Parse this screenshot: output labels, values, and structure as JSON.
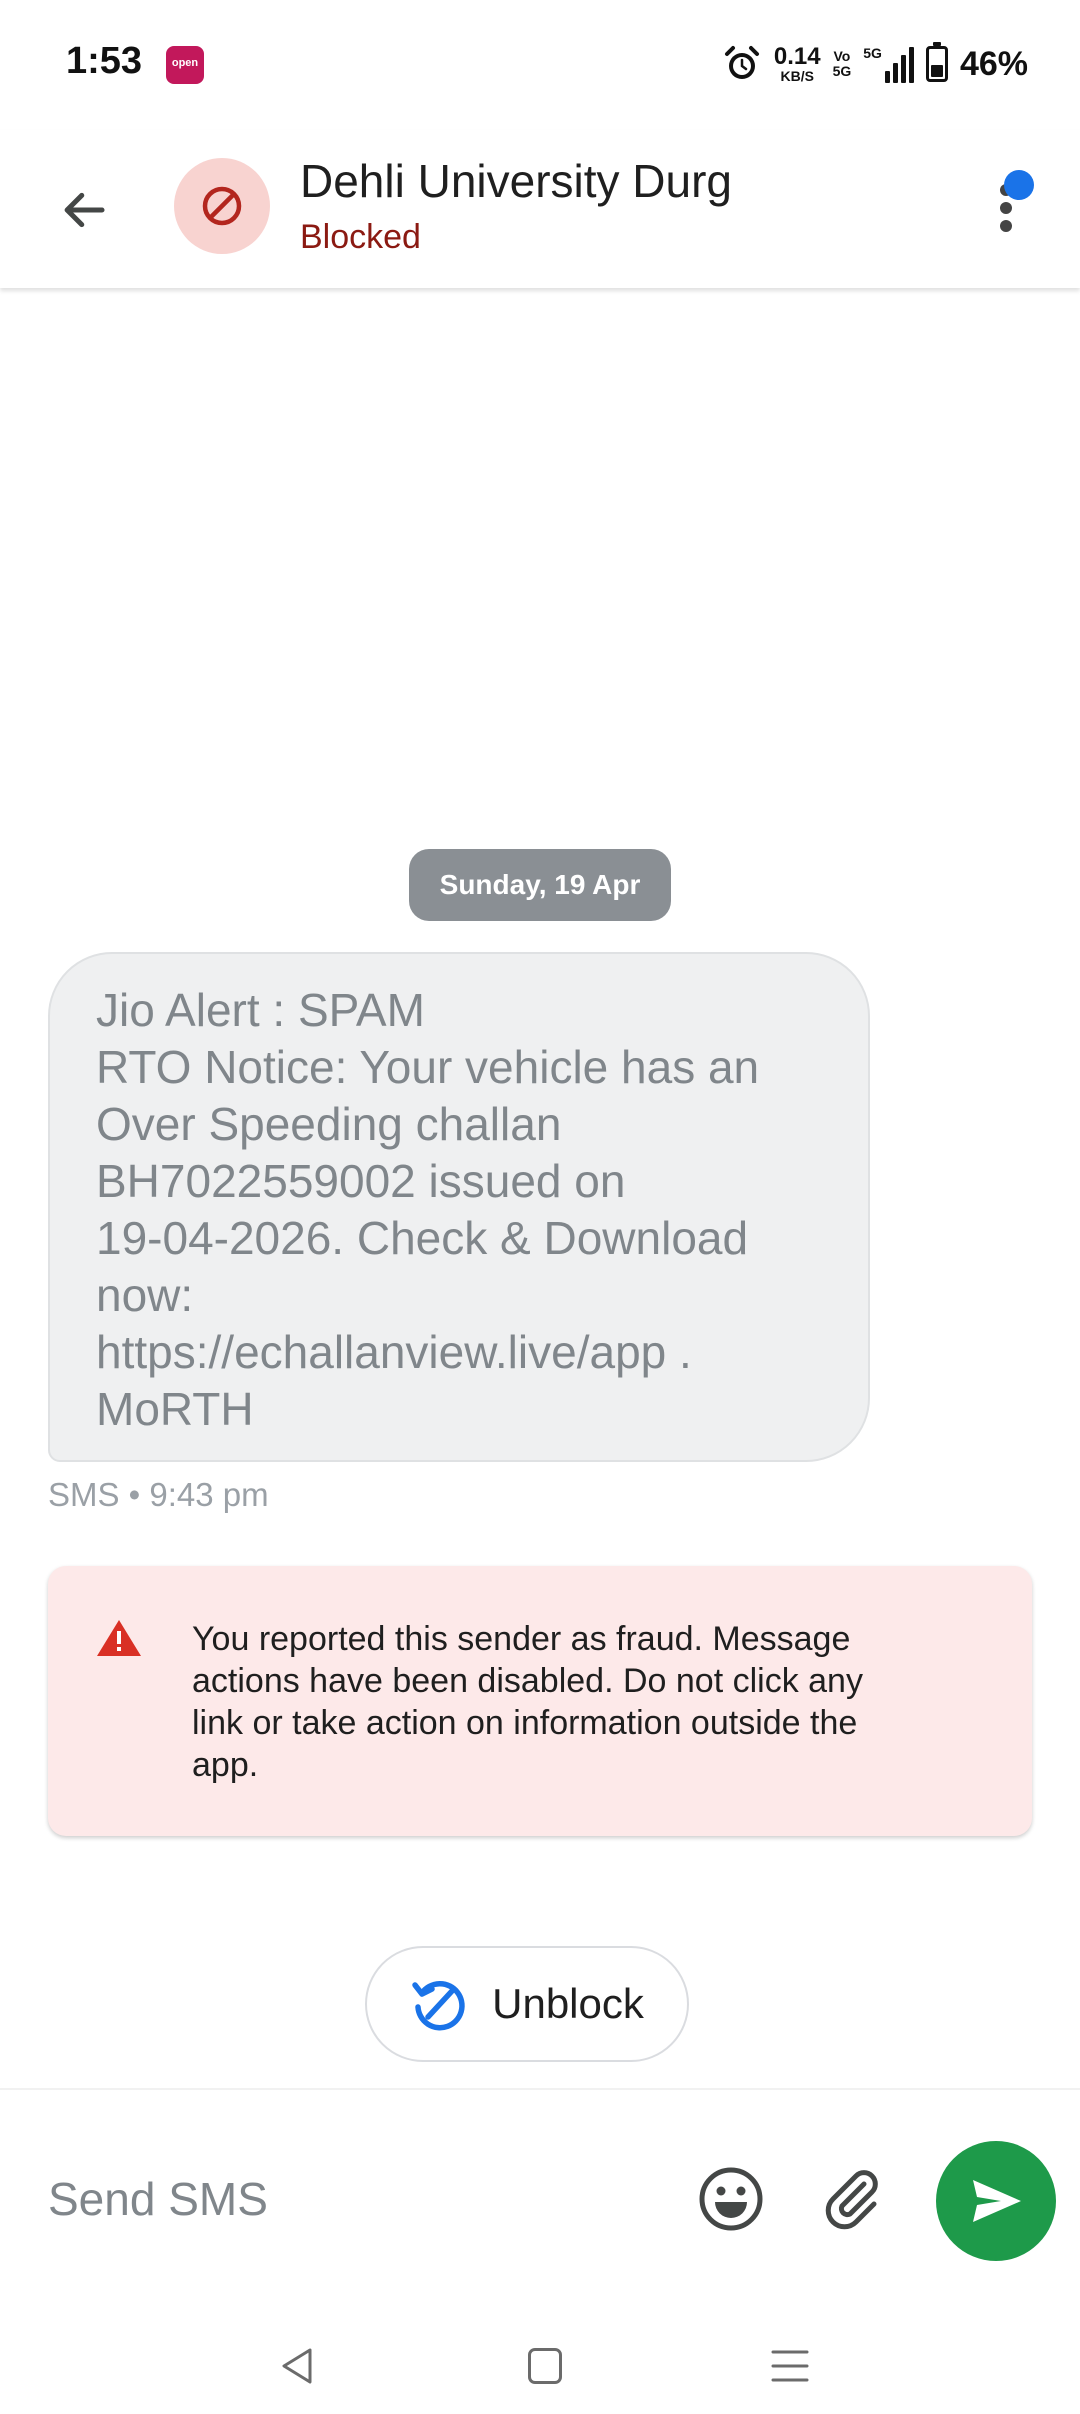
{
  "status_bar": {
    "time": "1:53",
    "app_badge": "open",
    "net_speed_value": "0.14",
    "net_speed_unit": "KB/S",
    "volte_top": "Vo",
    "volte_bottom": "5G",
    "network_label": "5G",
    "battery_level": 0.46,
    "battery_percent": "46%"
  },
  "header": {
    "contact_name": "Dehli University Durg",
    "status": "Blocked",
    "avatar_icon": "block-icon",
    "colors": {
      "avatar_bg": "#f8d3d0",
      "avatar_icon": "#b3261e",
      "status": "#8b1a12",
      "badge": "#1a73e8"
    }
  },
  "chat": {
    "date_chip": "Sunday, 19 Apr",
    "message": {
      "lines": [
        "Jio Alert : SPAM",
        "RTO Notice: Your vehicle has an",
        "Over Speeding challan",
        "BH7022559002 issued on",
        "19-04-2026. Check & Download",
        "now:",
        "https://echallanview.live/app .",
        "MoRTH"
      ],
      "meta": "SMS • 9:43 pm"
    },
    "warning": {
      "icon": "warning-icon",
      "lines": [
        "You reported this sender as fraud. Message",
        "actions have been disabled. Do not click any",
        "link or take action on information outside the",
        "app."
      ]
    },
    "unblock": {
      "label": "Unblock",
      "icon": "unblock-icon"
    }
  },
  "composer": {
    "placeholder": "Send SMS",
    "value": "",
    "send_color": "#1e9a4a"
  },
  "nav_bar": {
    "icons": [
      "nav-back-icon",
      "nav-home-icon",
      "nav-recents-icon"
    ]
  }
}
